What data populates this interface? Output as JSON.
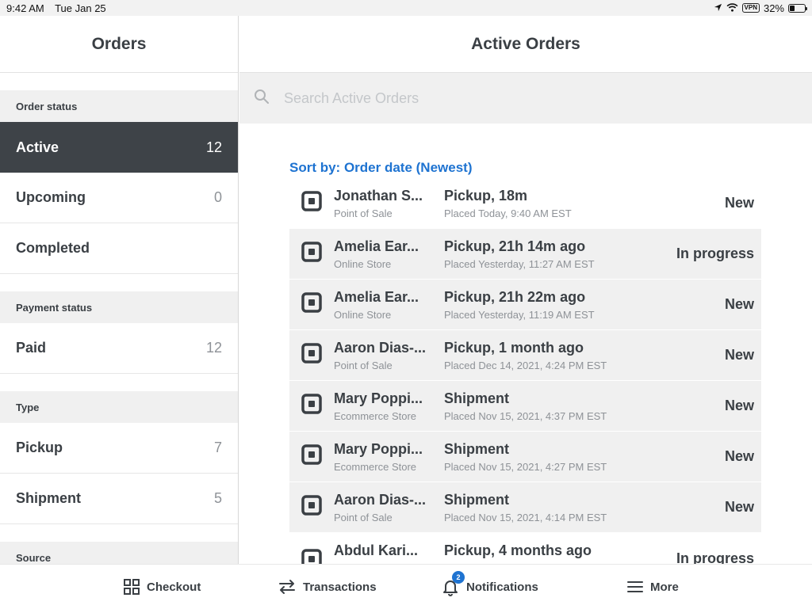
{
  "status_bar": {
    "time": "9:42 AM",
    "date": "Tue Jan 25",
    "vpn": "VPN",
    "battery": "32%"
  },
  "sidebar": {
    "title": "Orders",
    "sections": [
      {
        "title": "Order status",
        "items": [
          {
            "label": "Active",
            "count": "12",
            "selected": true
          },
          {
            "label": "Upcoming",
            "count": "0"
          },
          {
            "label": "Completed",
            "count": ""
          }
        ]
      },
      {
        "title": "Payment status",
        "items": [
          {
            "label": "Paid",
            "count": "12"
          }
        ]
      },
      {
        "title": "Type",
        "items": [
          {
            "label": "Pickup",
            "count": "7"
          },
          {
            "label": "Shipment",
            "count": "5"
          }
        ]
      },
      {
        "title": "Source",
        "items": []
      }
    ]
  },
  "main": {
    "title": "Active Orders",
    "search_placeholder": "Search Active Orders",
    "sort_label": "Sort by: Order date (Newest)",
    "orders": [
      {
        "customer": "Jonathan S...",
        "source": "Point of Sale",
        "fulfillment": "Pickup, 18m",
        "placed": "Placed Today, 9:40 AM EST",
        "status": "New"
      },
      {
        "customer": "Amelia Ear...",
        "source": "Online Store",
        "fulfillment": "Pickup, 21h 14m ago",
        "placed": "Placed Yesterday, 11:27 AM EST",
        "status": "In progress"
      },
      {
        "customer": "Amelia Ear...",
        "source": "Online Store",
        "fulfillment": "Pickup, 21h 22m ago",
        "placed": "Placed Yesterday, 11:19 AM EST",
        "status": "New"
      },
      {
        "customer": "Aaron Dias-...",
        "source": "Point of Sale",
        "fulfillment": "Pickup, 1 month ago",
        "placed": "Placed Dec 14, 2021, 4:24 PM EST",
        "status": "New"
      },
      {
        "customer": "Mary Poppi...",
        "source": "Ecommerce Store",
        "fulfillment": "Shipment",
        "placed": "Placed Nov 15, 2021, 4:37 PM EST",
        "status": "New"
      },
      {
        "customer": "Mary Poppi...",
        "source": "Ecommerce Store",
        "fulfillment": "Shipment",
        "placed": "Placed Nov 15, 2021, 4:27 PM EST",
        "status": "New"
      },
      {
        "customer": "Aaron Dias-...",
        "source": "Point of Sale",
        "fulfillment": "Shipment",
        "placed": "Placed Nov 15, 2021, 4:14 PM EST",
        "status": "New"
      },
      {
        "customer": "Abdul Kari...",
        "source": "",
        "fulfillment": "Pickup, 4 months ago",
        "placed": "",
        "status": "In progress"
      }
    ]
  },
  "tab_bar": {
    "tabs": [
      {
        "label": "Checkout",
        "icon": "grid-icon"
      },
      {
        "label": "Transactions",
        "icon": "arrows-icon"
      },
      {
        "label": "Notifications",
        "icon": "bell-icon",
        "badge": "2"
      },
      {
        "label": "More",
        "icon": "menu-icon"
      }
    ]
  },
  "colors": {
    "accent": "#1e73d1",
    "selected_bg": "#3e4348",
    "section_bg": "#f0f0f0",
    "text": "#3a3f44",
    "muted": "#8e9297"
  }
}
